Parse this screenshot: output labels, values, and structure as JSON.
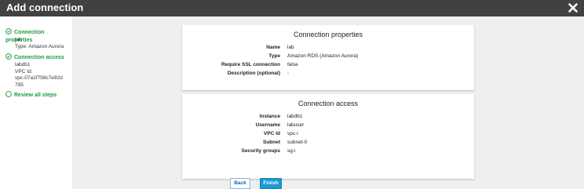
{
  "dialog": {
    "title": "Add connection",
    "close_icon": "close-icon"
  },
  "sidebar": {
    "steps": [
      {
        "label": "Connection properties",
        "details": [
          "lab",
          "Type: Amazon Aurora"
        ],
        "icon": "check-circle-icon"
      },
      {
        "label": "Connection access",
        "details": [
          "labdb1",
          "VPC Id:",
          "vpc-07a1f758c7e92d",
          "795"
        ],
        "icon": "check-circle-icon"
      },
      {
        "label": "Review all steps",
        "details": [],
        "icon": "circle-icon"
      }
    ]
  },
  "properties_card": {
    "title": "Connection properties",
    "rows": [
      {
        "key": "Name",
        "value": "lab"
      },
      {
        "key": "Type",
        "value": "Amazon RDS (Amazon Aurora)"
      },
      {
        "key": "Require SSL connection",
        "value": "false"
      },
      {
        "key": "Description (optional)",
        "value": "-"
      }
    ]
  },
  "access_card": {
    "title": "Connection access",
    "rows": [
      {
        "key": "Instance",
        "value": "labdb1"
      },
      {
        "key": "Username",
        "value": "labuser"
      },
      {
        "key": "VPC Id",
        "value": "vpc-i"
      },
      {
        "key": "Subnet",
        "value": "subnet-0"
      },
      {
        "key": "Security groups",
        "value": "sg-i"
      }
    ]
  },
  "footer": {
    "back_label": "Back",
    "finish_label": "Finish"
  },
  "colors": {
    "header_bg": "#3f4142",
    "step_green": "#1a9c3e",
    "primary_button": "#1a9ad6"
  }
}
